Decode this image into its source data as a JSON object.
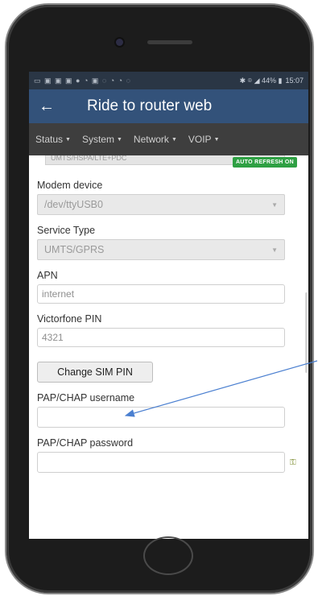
{
  "statusbar": {
    "left_icons": "▭ ▣ ▣ ▣ ● ◔ ▣ ◌ ◔ ◔ ◌",
    "signal": "✱ ⌾ ◢ 44% ▮",
    "time": "15:07"
  },
  "appbar": {
    "title": "Ride to router web"
  },
  "nav": [
    {
      "label": "Status"
    },
    {
      "label": "System"
    },
    {
      "label": "Network"
    },
    {
      "label": "VOIP"
    }
  ],
  "auto_refresh": "AUTO REFRESH ON",
  "partial_value": "UMTS/HSPA/LTE+PDC",
  "form": {
    "modem_device": {
      "label": "Modem device",
      "value": "/dev/ttyUSB0"
    },
    "service_type": {
      "label": "Service Type",
      "value": "UMTS/GPRS"
    },
    "apn": {
      "label": "APN",
      "value": "internet"
    },
    "pin": {
      "label": "Victorfone PIN",
      "value": "4321"
    },
    "change_pin_button": "Change SIM PIN",
    "username": {
      "label": "PAP/CHAP username",
      "value": ""
    },
    "password": {
      "label": "PAP/CHAP password",
      "value": ""
    }
  },
  "colors": {
    "appbar": "#33527a",
    "navbar": "#3e3e3e",
    "badge": "#2ea043",
    "annotation_arrow": "#4a7fd0"
  },
  "icons": [
    "back-arrow-icon",
    "caret-down-icon",
    "chevron-down-icon",
    "key-icon"
  ]
}
